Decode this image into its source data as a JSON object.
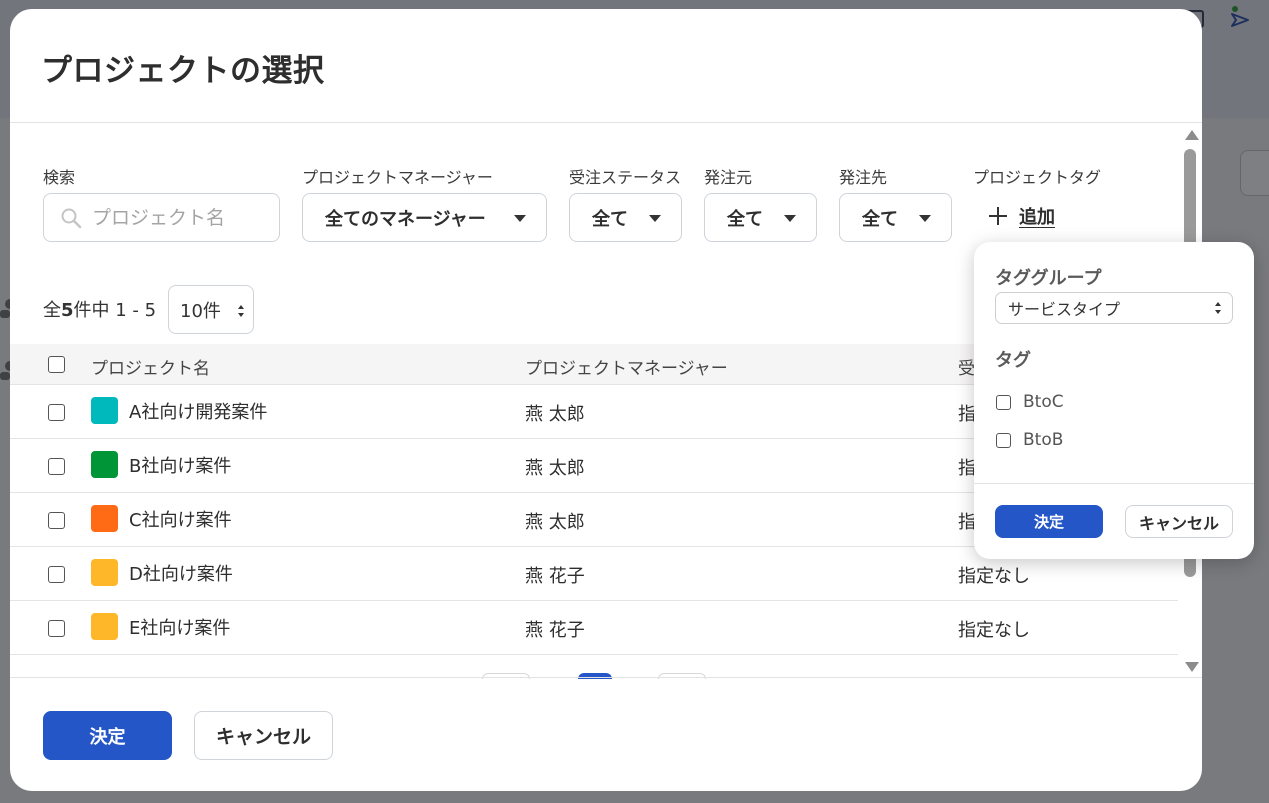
{
  "modal": {
    "title": "プロジェクトの選択"
  },
  "filters": {
    "search_label": "検索",
    "search_placeholder": "プロジェクト名",
    "manager_label": "プロジェクトマネージャー",
    "manager_value": "全てのマネージャー",
    "order_status_label": "受注ステータス",
    "order_status_value": "全て",
    "client_label": "発注元",
    "client_value": "全て",
    "vendor_label": "発注先",
    "vendor_value": "全て",
    "tag_label": "プロジェクトタグ",
    "add_label": "追加"
  },
  "pagination": {
    "prefix": "全",
    "total": "5",
    "suffix": "件中 1 - 5",
    "per_page": "10件"
  },
  "table": {
    "columns": [
      "プロジェクト名",
      "プロジェクトマネージャー",
      "受"
    ],
    "rows": [
      {
        "name": "A社向け開発案件",
        "color": "#00b9bd",
        "manager": "燕 太郎",
        "status": "指"
      },
      {
        "name": "B社向け案件",
        "color": "#009638",
        "manager": "燕 太郎",
        "status": "指"
      },
      {
        "name": "C社向け案件",
        "color": "#ff6a14",
        "manager": "燕 太郎",
        "status": "指"
      },
      {
        "name": "D社向け案件",
        "color": "#ffb72a",
        "manager": "燕 花子",
        "status": "指定なし"
      },
      {
        "name": "E社向け案件",
        "color": "#ffb72a",
        "manager": "燕 花子",
        "status": "指定なし"
      }
    ]
  },
  "footer": {
    "confirm_label": "決定",
    "cancel_label": "キャンセル"
  },
  "tag_popover": {
    "group_heading": "タググループ",
    "group_value": "サービスタイプ",
    "tag_heading": "タグ",
    "tags": [
      "BtoC",
      "BtoB"
    ],
    "confirm_label": "決定",
    "cancel_label": "キャンセル"
  },
  "colors": {
    "primary": "#2556c8"
  }
}
